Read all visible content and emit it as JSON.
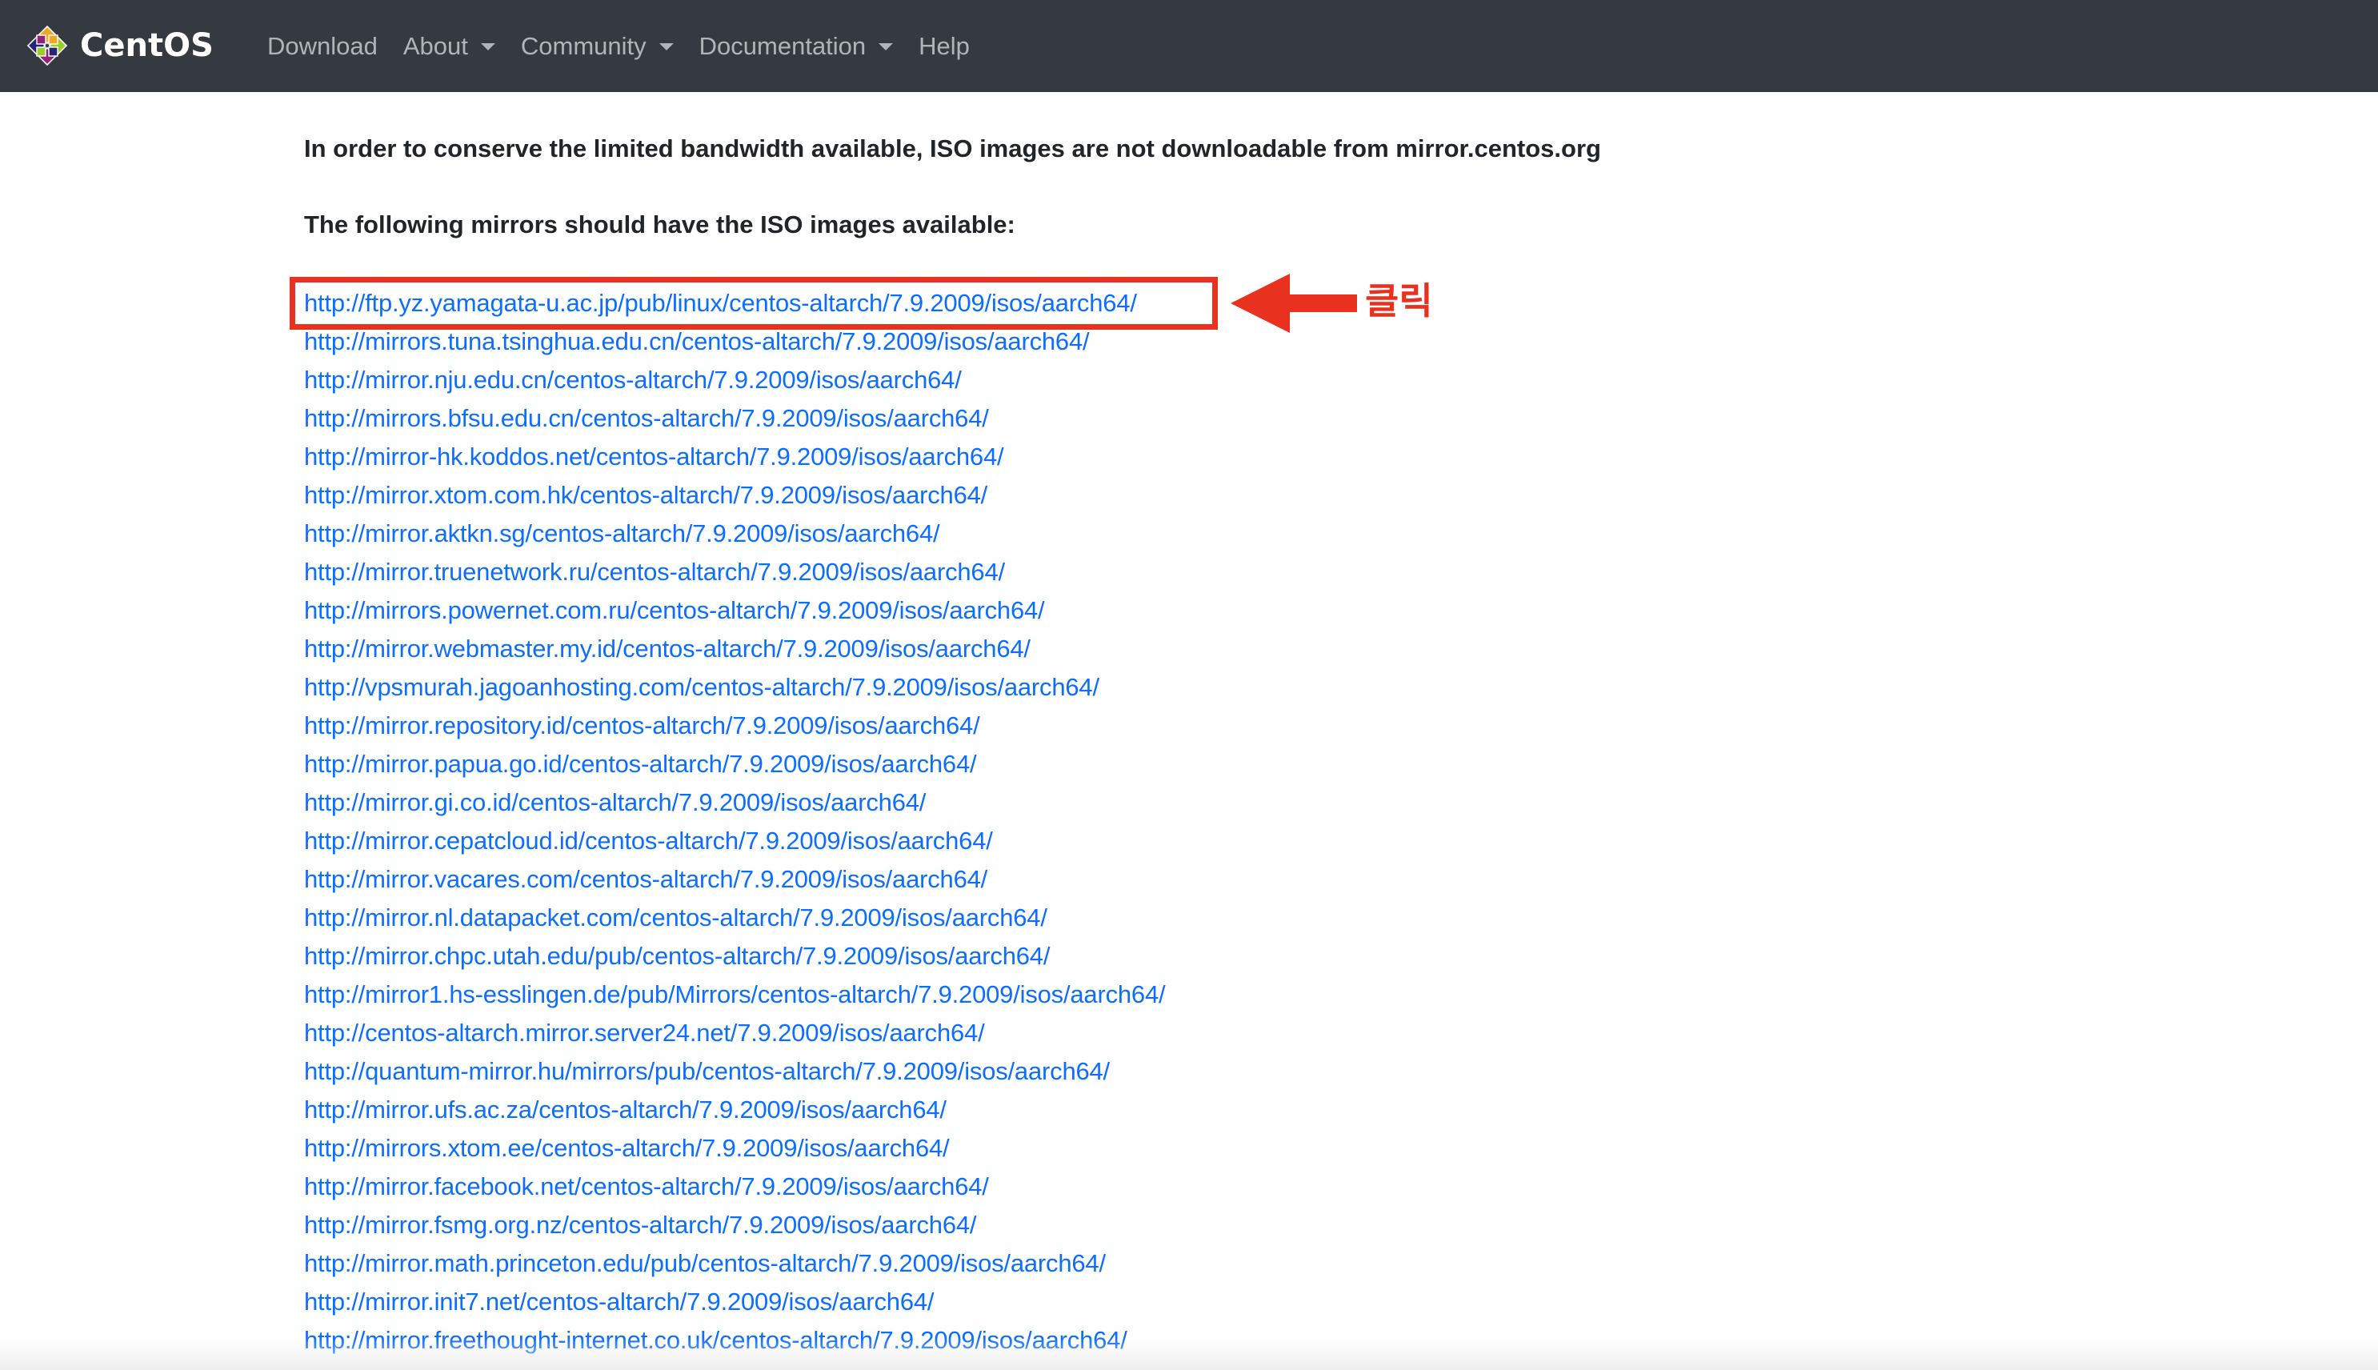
{
  "navbar": {
    "brand_text": "CentOS",
    "brand_icon": "centos-logo-icon",
    "items": [
      {
        "label": "Download",
        "has_dropdown": false
      },
      {
        "label": "About",
        "has_dropdown": true
      },
      {
        "label": "Community",
        "has_dropdown": true
      },
      {
        "label": "Documentation",
        "has_dropdown": true
      },
      {
        "label": "Help",
        "has_dropdown": false
      }
    ]
  },
  "content": {
    "notice": "In order to conserve the limited bandwidth available, ISO images are not downloadable from mirror.centos.org",
    "mirrors_heading": "The following mirrors should have the ISO images available:",
    "mirrors": [
      "http://ftp.yz.yamagata-u.ac.jp/pub/linux/centos-altarch/7.9.2009/isos/aarch64/",
      "http://mirrors.tuna.tsinghua.edu.cn/centos-altarch/7.9.2009/isos/aarch64/",
      "http://mirror.nju.edu.cn/centos-altarch/7.9.2009/isos/aarch64/",
      "http://mirrors.bfsu.edu.cn/centos-altarch/7.9.2009/isos/aarch64/",
      "http://mirror-hk.koddos.net/centos-altarch/7.9.2009/isos/aarch64/",
      "http://mirror.xtom.com.hk/centos-altarch/7.9.2009/isos/aarch64/",
      "http://mirror.aktkn.sg/centos-altarch/7.9.2009/isos/aarch64/",
      "http://mirror.truenetwork.ru/centos-altarch/7.9.2009/isos/aarch64/",
      "http://mirrors.powernet.com.ru/centos-altarch/7.9.2009/isos/aarch64/",
      "http://mirror.webmaster.my.id/centos-altarch/7.9.2009/isos/aarch64/",
      "http://vpsmurah.jagoanhosting.com/centos-altarch/7.9.2009/isos/aarch64/",
      "http://mirror.repository.id/centos-altarch/7.9.2009/isos/aarch64/",
      "http://mirror.papua.go.id/centos-altarch/7.9.2009/isos/aarch64/",
      "http://mirror.gi.co.id/centos-altarch/7.9.2009/isos/aarch64/",
      "http://mirror.cepatcloud.id/centos-altarch/7.9.2009/isos/aarch64/",
      "http://mirror.vacares.com/centos-altarch/7.9.2009/isos/aarch64/",
      "http://mirror.nl.datapacket.com/centos-altarch/7.9.2009/isos/aarch64/",
      "http://mirror.chpc.utah.edu/pub/centos-altarch/7.9.2009/isos/aarch64/",
      "http://mirror1.hs-esslingen.de/pub/Mirrors/centos-altarch/7.9.2009/isos/aarch64/",
      "http://centos-altarch.mirror.server24.net/7.9.2009/isos/aarch64/",
      "http://quantum-mirror.hu/mirrors/pub/centos-altarch/7.9.2009/isos/aarch64/",
      "http://mirror.ufs.ac.za/centos-altarch/7.9.2009/isos/aarch64/",
      "http://mirrors.xtom.ee/centos-altarch/7.9.2009/isos/aarch64/",
      "http://mirror.facebook.net/centos-altarch/7.9.2009/isos/aarch64/",
      "http://mirror.fsmg.org.nz/centos-altarch/7.9.2009/isos/aarch64/",
      "http://mirror.math.princeton.edu/pub/centos-altarch/7.9.2009/isos/aarch64/",
      "http://mirror.init7.net/centos-altarch/7.9.2009/isos/aarch64/",
      "http://mirror.freethought-internet.co.uk/centos-altarch/7.9.2009/isos/aarch64/"
    ]
  },
  "annotation": {
    "label": "클릭",
    "color": "#e8311f",
    "arrow_icon": "left-arrow-icon"
  },
  "colors": {
    "navbar_bg": "#343a40",
    "link": "#0d6efd",
    "text": "#212529"
  }
}
